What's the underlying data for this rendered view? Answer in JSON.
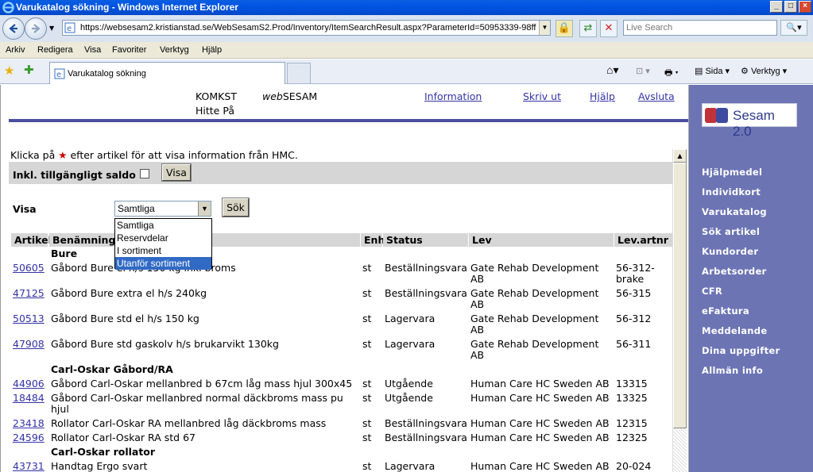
{
  "window": {
    "title": "Varukatalog sökning - Windows Internet Explorer",
    "controls": [
      "_",
      "□",
      "×"
    ]
  },
  "addressbar": {
    "url": "https://websesam2.kristianstad.se/WebSesamS2.Prod/Inventory/ItemSearchResult.aspx?ParameterId=50953339-98ff",
    "search_placeholder": "Live Search"
  },
  "menu": [
    "Arkiv",
    "Redigera",
    "Visa",
    "Favoriter",
    "Verktyg",
    "Hjälp"
  ],
  "tab": {
    "title": "Varukatalog sökning"
  },
  "commandbar": {
    "sida": "Sida",
    "verktyg": "Verktyg"
  },
  "header": {
    "komkst": "KOMKST",
    "websesam_prefix": "web",
    "websesam_suffix": "SESAM",
    "hitte": "Hitte På",
    "links": [
      "Information",
      "Skriv ut",
      "Hjälp",
      "Avsluta"
    ]
  },
  "sidebar": {
    "logo_text": "Sesam 2.0",
    "items": [
      "Hjälpmedel",
      "Individkort",
      "Varukatalog",
      "Sök artikel",
      "Kundorder",
      "Arbetsorder",
      "CFR",
      "eFaktura",
      "Meddelande",
      "Dina uppgifter",
      "Allmän info"
    ]
  },
  "intro": {
    "before": "Klicka på ",
    "star": "★",
    "after": " efter artikel för att visa information från HMC."
  },
  "saldo": {
    "label": "Inkl. tillgängligt saldo",
    "button": "Visa"
  },
  "filter": {
    "label": "Visa",
    "selected": "Samtliga",
    "options": [
      "Samtliga",
      "Reservdelar",
      "I sortiment",
      "Utanför sortiment"
    ],
    "highlighted_index": 3,
    "search_button": "Sök"
  },
  "table": {
    "columns": [
      "Artikel",
      "Benämning",
      "Enh",
      "Status",
      "Lev",
      "Lev.artnr"
    ],
    "rows": [
      {
        "type": "group",
        "name": "Bure"
      },
      {
        "type": "item",
        "artikel": "50605",
        "benamning": "Gåbord Bure el h/s 150 kg inkl broms",
        "enh": "st",
        "status": "Beställningsvara",
        "lev": "Gate Rehab Development AB",
        "levartnr": "56-312-brake"
      },
      {
        "type": "item",
        "artikel": "47125",
        "benamning": "Gåbord Bure extra el h/s 240kg",
        "enh": "st",
        "status": "Beställningsvara",
        "lev": "Gate Rehab Development AB",
        "levartnr": "56-315"
      },
      {
        "type": "item",
        "artikel": "50513",
        "benamning": "Gåbord Bure std el h/s 150 kg",
        "enh": "st",
        "status": "Lagervara",
        "lev": "Gate Rehab Development AB",
        "levartnr": "56-312"
      },
      {
        "type": "item",
        "artikel": "47908",
        "benamning": "Gåbord Bure std gaskolv h/s brukarvikt 130kg",
        "enh": "st",
        "status": "Lagervara",
        "lev": "Gate Rehab Development AB",
        "levartnr": "56-311"
      },
      {
        "type": "group",
        "name": "Carl-Oskar Gåbord/RA"
      },
      {
        "type": "item",
        "artikel": "44906",
        "benamning": "Gåbord Carl-Oskar mellanbred b 67cm låg mass hjul 300x45",
        "enh": "st",
        "status": "Utgående",
        "lev": "Human Care HC Sweden AB",
        "levartnr": "13315"
      },
      {
        "type": "item",
        "artikel": "18484",
        "benamning": "Gåbord Carl-Oskar mellanbred normal däckbroms mass pu hjul",
        "enh": "st",
        "status": "Utgående",
        "lev": "Human Care HC Sweden AB",
        "levartnr": "13325"
      },
      {
        "type": "item",
        "artikel": "23418",
        "benamning": "Rollator Carl-Oskar RA mellanbred låg däckbroms mass",
        "enh": "st",
        "status": "Beställningsvara",
        "lev": "Human Care HC Sweden AB",
        "levartnr": "12315"
      },
      {
        "type": "item",
        "artikel": "24596",
        "benamning": "Rollator Carl-Oskar RA std 67",
        "enh": "st",
        "status": "Beställningsvara",
        "lev": "Human Care HC Sweden AB",
        "levartnr": "12325"
      },
      {
        "type": "group",
        "name": "Carl-Oskar rollator"
      },
      {
        "type": "item",
        "artikel": "43731",
        "benamning": "Handtag Ergo svart",
        "enh": "st",
        "status": "Lagervara",
        "lev": "Human Care HC Sweden AB",
        "levartnr": "20-024"
      }
    ]
  }
}
